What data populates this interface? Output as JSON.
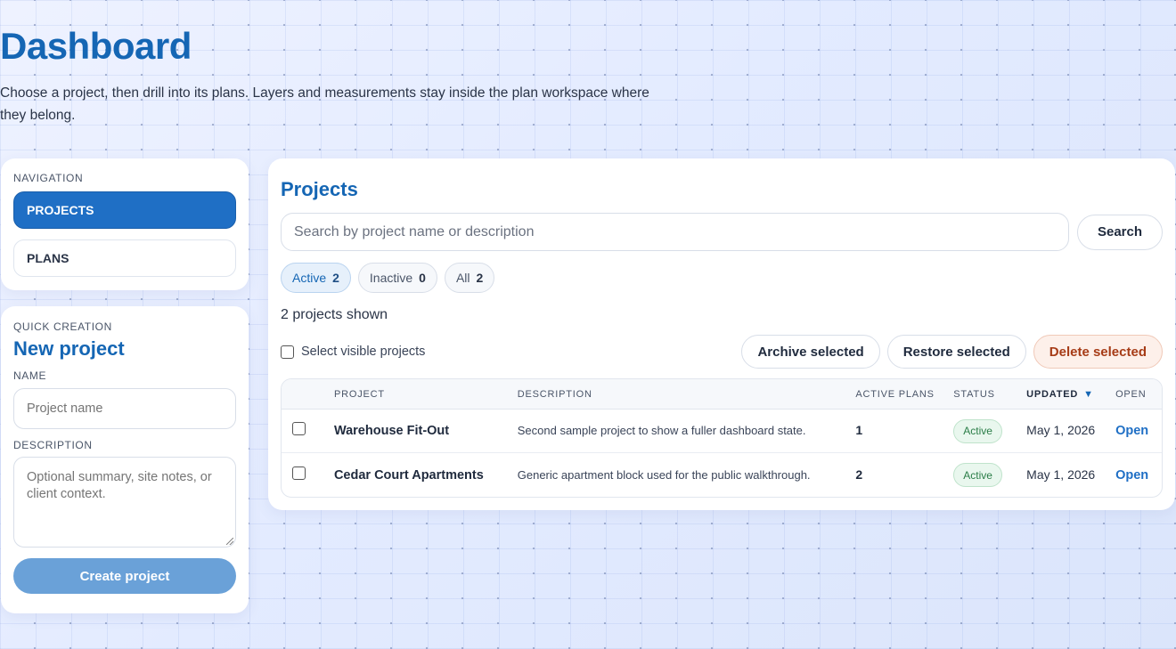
{
  "header": {
    "title": "Dashboard",
    "subtitle": "Choose a project, then drill into its plans. Layers and measurements stay inside the plan workspace where they belong."
  },
  "navigation": {
    "eyebrow": "NAVIGATION",
    "items": [
      {
        "label": "PROJECTS",
        "active": true
      },
      {
        "label": "PLANS",
        "active": false
      }
    ]
  },
  "quick_create": {
    "eyebrow": "QUICK CREATION",
    "title": "New project",
    "name_label": "NAME",
    "name_placeholder": "Project name",
    "description_label": "DESCRIPTION",
    "description_placeholder": "Optional summary, site notes, or client context.",
    "submit_label": "Create project"
  },
  "projects": {
    "title": "Projects",
    "search_placeholder": "Search by project name or description",
    "search_button": "Search",
    "filters": [
      {
        "label": "Active",
        "count": "2",
        "active": true
      },
      {
        "label": "Inactive",
        "count": "0",
        "active": false
      },
      {
        "label": "All",
        "count": "2",
        "active": false
      }
    ],
    "shown_text": "2 projects shown",
    "select_visible_label": "Select visible projects",
    "bulk_actions": {
      "archive": "Archive selected",
      "restore": "Restore selected",
      "delete": "Delete selected"
    },
    "columns": {
      "project": "PROJECT",
      "description": "DESCRIPTION",
      "active_plans": "ACTIVE PLANS",
      "status": "STATUS",
      "updated": "UPDATED",
      "open": "OPEN"
    },
    "rows": [
      {
        "name": "Warehouse Fit-Out",
        "description": "Second sample project to show a fuller dashboard state.",
        "active_plans": "1",
        "status": "Active",
        "updated": "May 1, 2026",
        "open": "Open"
      },
      {
        "name": "Cedar Court Apartments",
        "description": "Generic apartment block used for the public walkthrough.",
        "active_plans": "2",
        "status": "Active",
        "updated": "May 1, 2026",
        "open": "Open"
      }
    ]
  },
  "colors": {
    "accent": "#1566b4",
    "primary_button": "#1f6fc5",
    "danger": "#a63b16",
    "success": "#2a7d47"
  }
}
